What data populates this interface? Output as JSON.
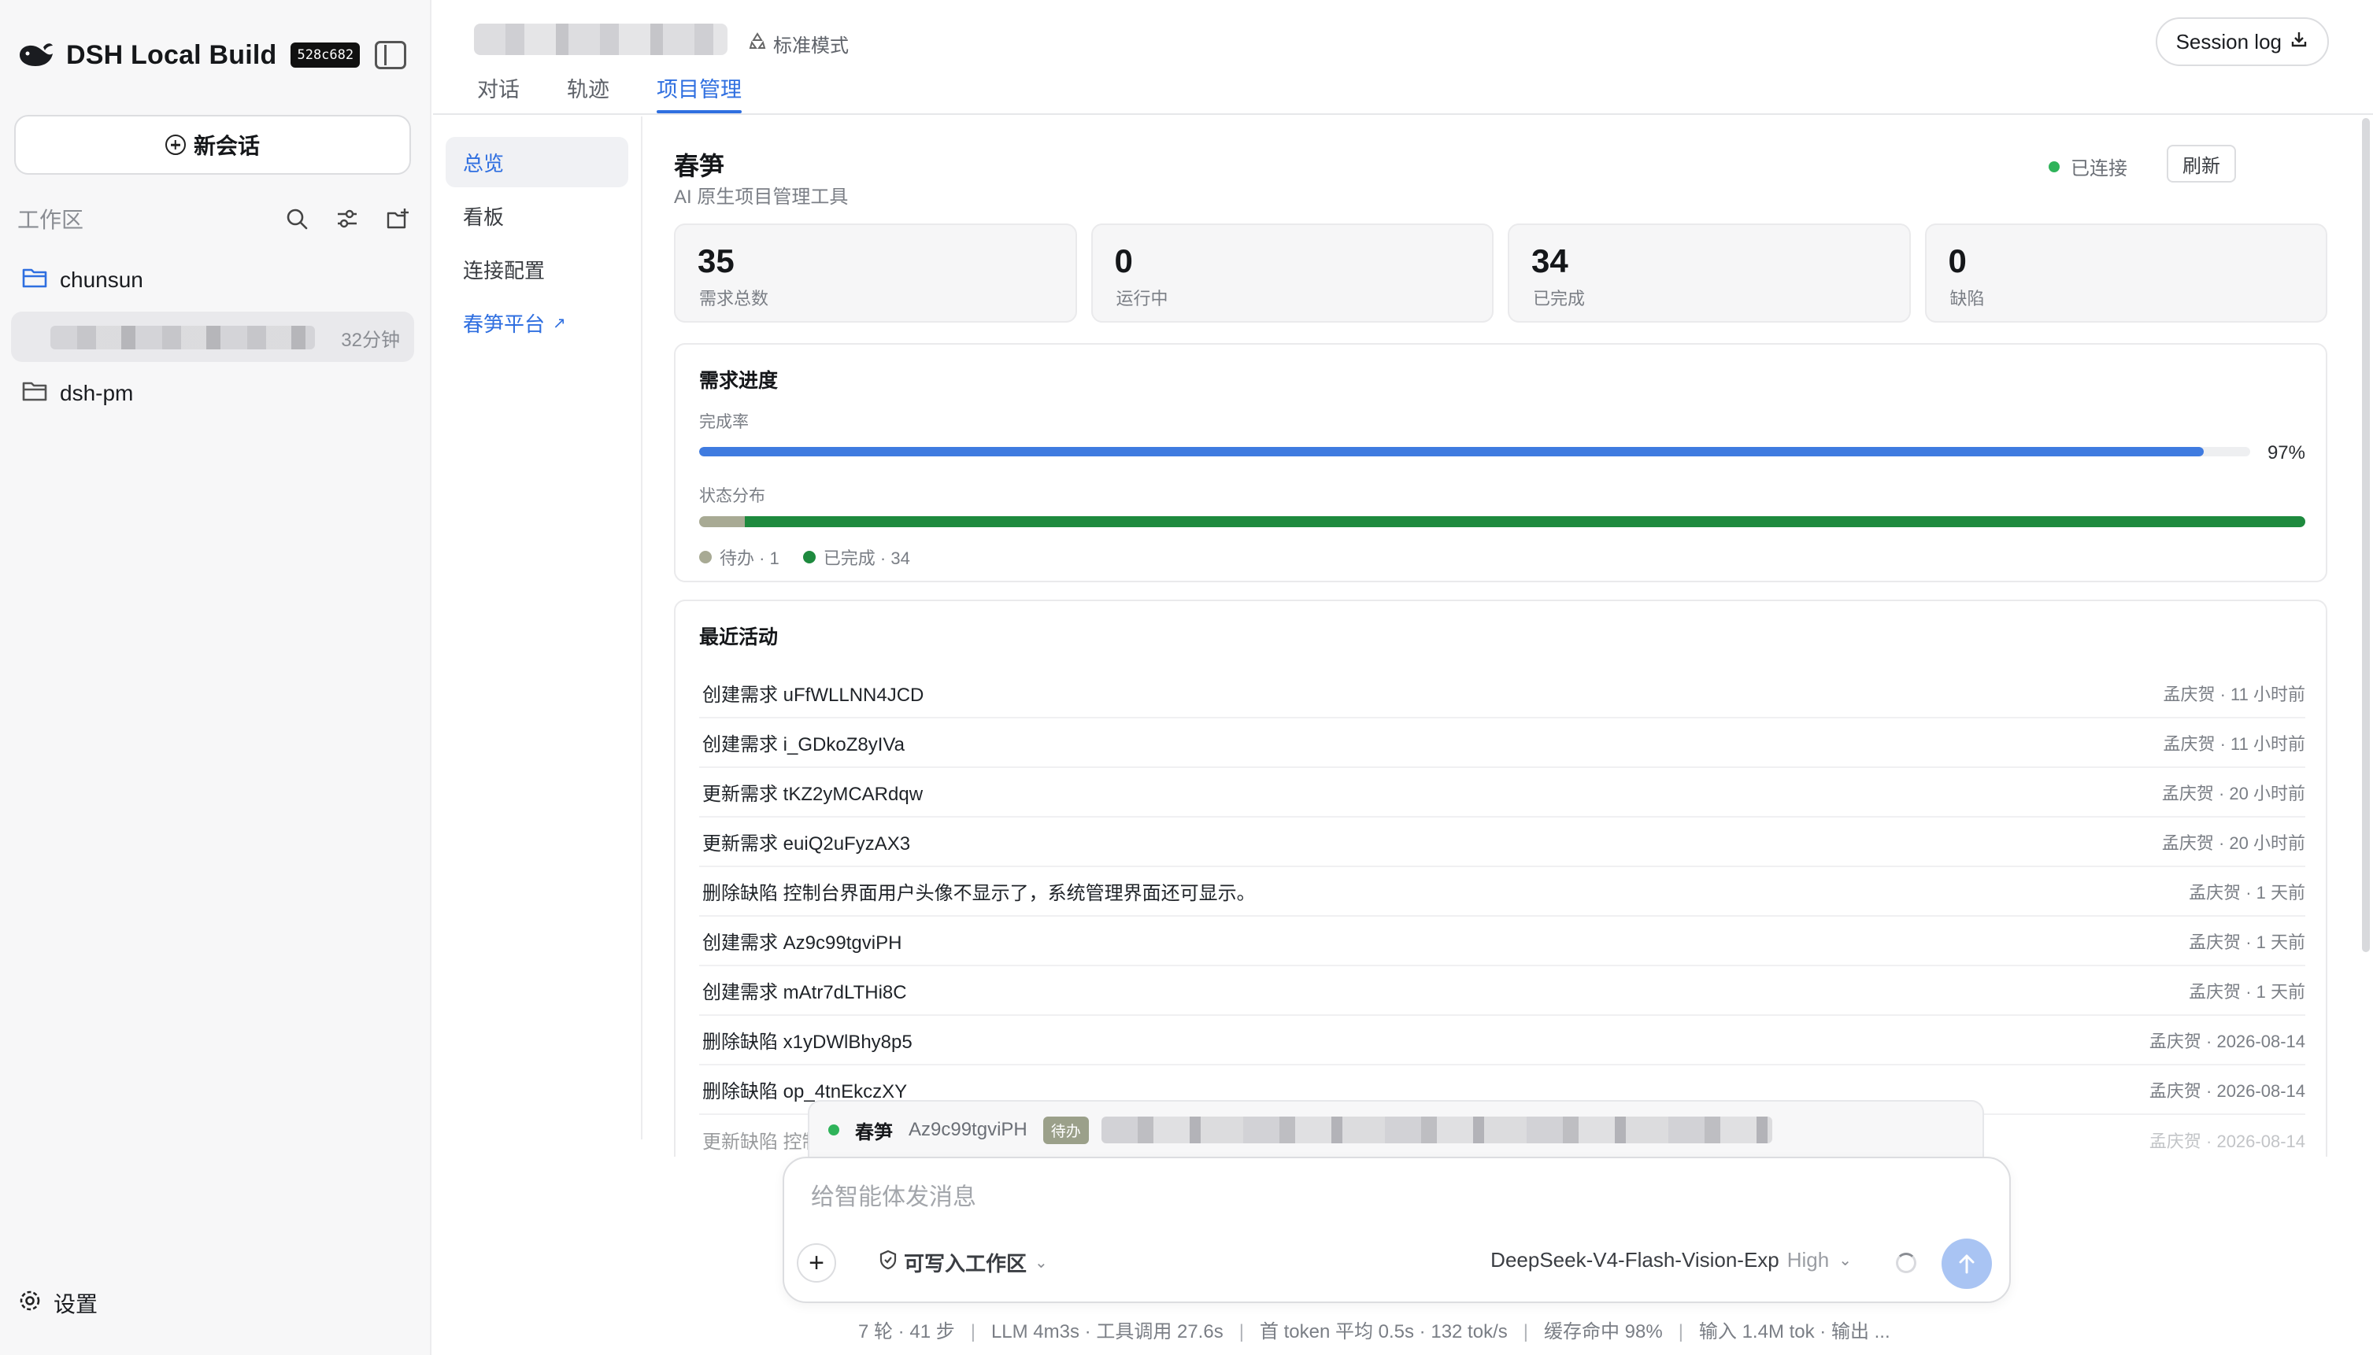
{
  "app": {
    "name": "DSH Local Build",
    "build_badge": "528c682"
  },
  "sidebar": {
    "new_chat_label": "新会话",
    "workspace_label": "工作区",
    "folders": [
      {
        "name": "chunsun",
        "icon": "folder-open-icon"
      },
      {
        "name": "dsh-pm",
        "icon": "folder-icon"
      }
    ],
    "session_time": "32分钟",
    "settings_label": "设置"
  },
  "topbar": {
    "mode_label": "标准模式",
    "tabs": [
      {
        "label": "对话",
        "active": false
      },
      {
        "label": "轨迹",
        "active": false
      },
      {
        "label": "项目管理",
        "active": true
      }
    ],
    "session_log_label": "Session log"
  },
  "subnav": {
    "items": [
      {
        "label": "总览",
        "active": true
      },
      {
        "label": "看板",
        "active": false
      },
      {
        "label": "连接配置",
        "active": false
      },
      {
        "label": "春笋平台",
        "link": true
      }
    ]
  },
  "project": {
    "title": "春笋",
    "subtitle": "AI 原生项目管理工具",
    "connection_status": "已连接",
    "refresh_label": "刷新"
  },
  "stats": [
    {
      "value": "35",
      "label": "需求总数"
    },
    {
      "value": "0",
      "label": "运行中"
    },
    {
      "value": "34",
      "label": "已完成"
    },
    {
      "value": "0",
      "label": "缺陷"
    }
  ],
  "progress": {
    "title": "需求进度",
    "completion_label": "完成率",
    "completion_pct": 97,
    "completion_text": "97%",
    "distribution_label": "状态分布",
    "distribution": [
      {
        "label": "待办 · 1",
        "count": 1,
        "color": "#a8aa94"
      },
      {
        "label": "已完成 · 34",
        "count": 34,
        "color": "#1e8a3e"
      }
    ]
  },
  "activity": {
    "title": "最近活动",
    "items": [
      {
        "text": "创建需求 uFfWLLNN4JCD",
        "meta": "孟庆贺 · 11 小时前"
      },
      {
        "text": "创建需求 i_GDkoZ8yIVa",
        "meta": "孟庆贺 · 11 小时前"
      },
      {
        "text": "更新需求 tKZ2yMCARdqw",
        "meta": "孟庆贺 · 20 小时前"
      },
      {
        "text": "更新需求 euiQ2uFyzAX3",
        "meta": "孟庆贺 · 20 小时前"
      },
      {
        "text": "删除缺陷 控制台界面用户头像不显示了，系统管理界面还可显示。",
        "meta": "孟庆贺 · 1 天前"
      },
      {
        "text": "创建需求 Az9c99tgviPH",
        "meta": "孟庆贺 · 1 天前"
      },
      {
        "text": "创建需求 mAtr7dLTHi8C",
        "meta": "孟庆贺 · 1 天前"
      },
      {
        "text": "删除缺陷 x1yDWlBhy8p5",
        "meta": "孟庆贺 · 2026-08-14"
      },
      {
        "text": "删除缺陷 op_4tnEkczXY",
        "meta": "孟庆贺 · 2026-08-14"
      },
      {
        "text": "更新缺陷 控制",
        "meta": "孟庆贺 · 2026-08-14"
      }
    ]
  },
  "task_popup": {
    "project": "春笋",
    "id": "Az9c99tgviPH",
    "status": "待办"
  },
  "composer": {
    "placeholder": "给智能体发消息",
    "permission_label": "可写入工作区",
    "model_name": "DeepSeek-V4-Flash-Vision-Exp",
    "effort": "High"
  },
  "statusbar": {
    "items": [
      "7 轮 · 41 步",
      "LLM 4m3s · 工具调用 27.6s",
      "首 token 平均 0.5s · 132 tok/s",
      "缓存命中 98%",
      "输入 1.4M tok · 输出 ..."
    ]
  },
  "colors": {
    "accent": "#2f6fe0",
    "progress_bar": "#3f7be0",
    "connected": "#2fb35a"
  }
}
